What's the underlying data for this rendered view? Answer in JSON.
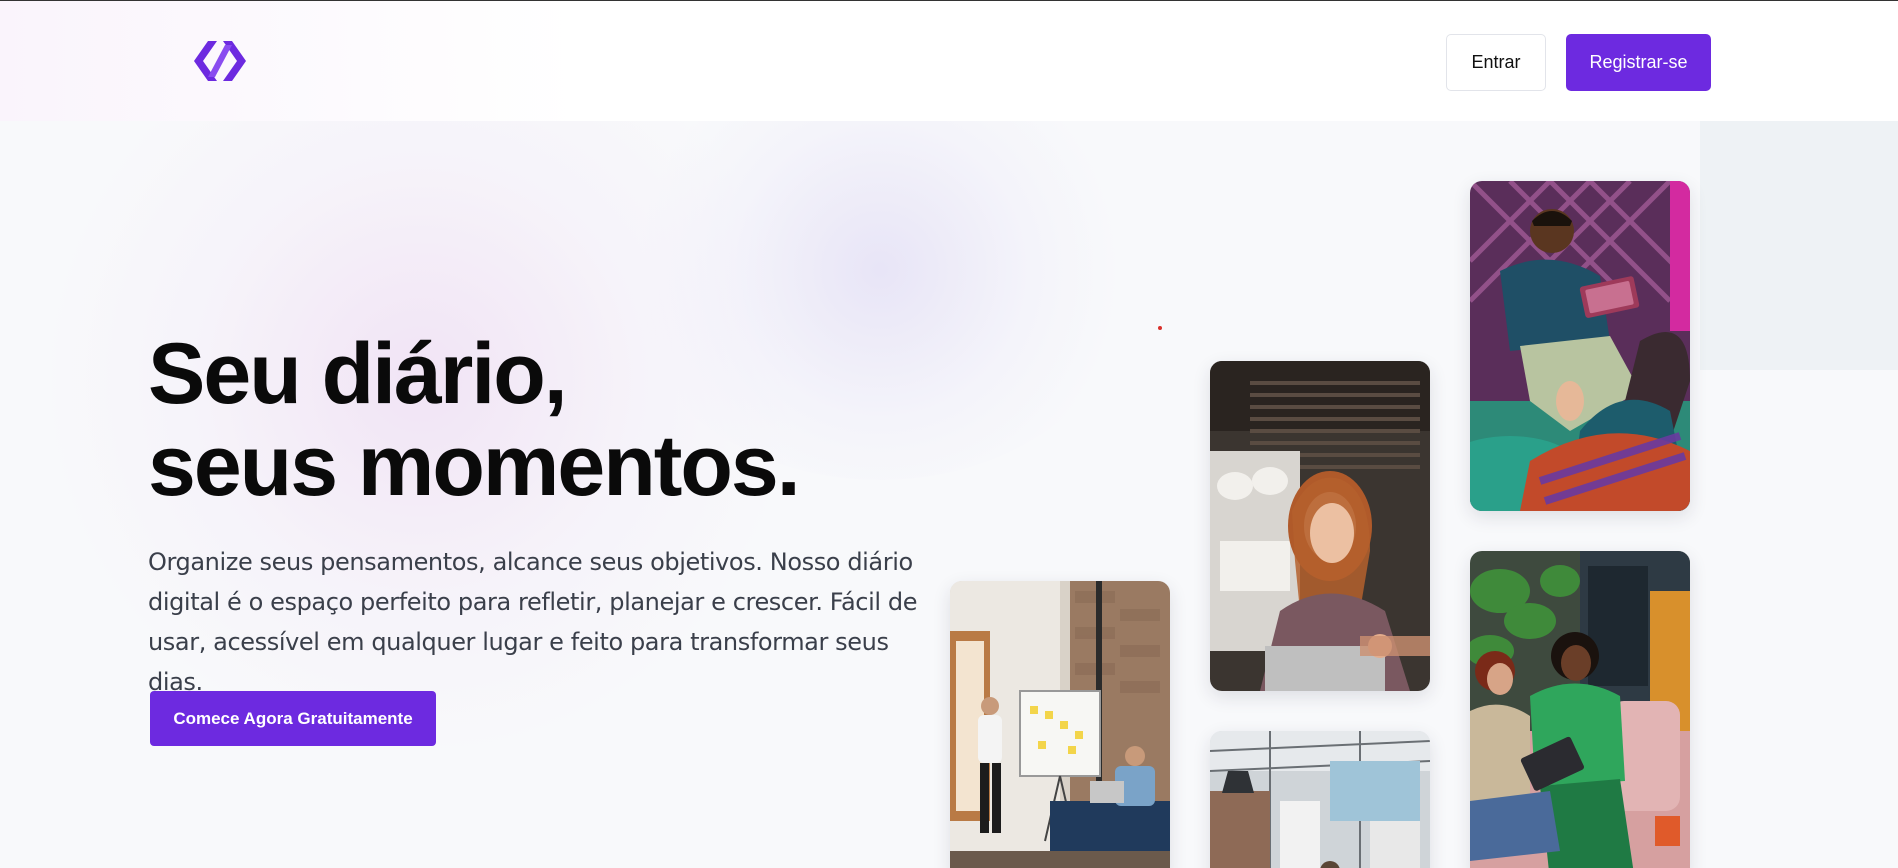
{
  "header": {
    "logo": "code-brackets-logo",
    "login_label": "Entrar",
    "register_label": "Registrar-se"
  },
  "hero": {
    "title_line1": "Seu diário,",
    "title_line2": "seus momentos.",
    "description": "Organize seus pensamentos, alcance seus objetivos. Nosso diário digital é o espaço perfeito para refletir, planejar e crescer. Fácil de usar, acessível em qualquer lugar e feito para transformar seus dias.",
    "cta_label": "Comece Agora Gratuitamente"
  },
  "colors": {
    "brand": "#6d2ae0",
    "background": "#f8f9fb",
    "heading": "#0a0a0a",
    "body_text": "#3a3f4a"
  },
  "gallery": [
    {
      "name": "office-whiteboard-photo"
    },
    {
      "name": "woman-laptop-photo"
    },
    {
      "name": "industrial-office-photo"
    },
    {
      "name": "man-tablet-photo"
    },
    {
      "name": "women-sofa-photo"
    }
  ]
}
